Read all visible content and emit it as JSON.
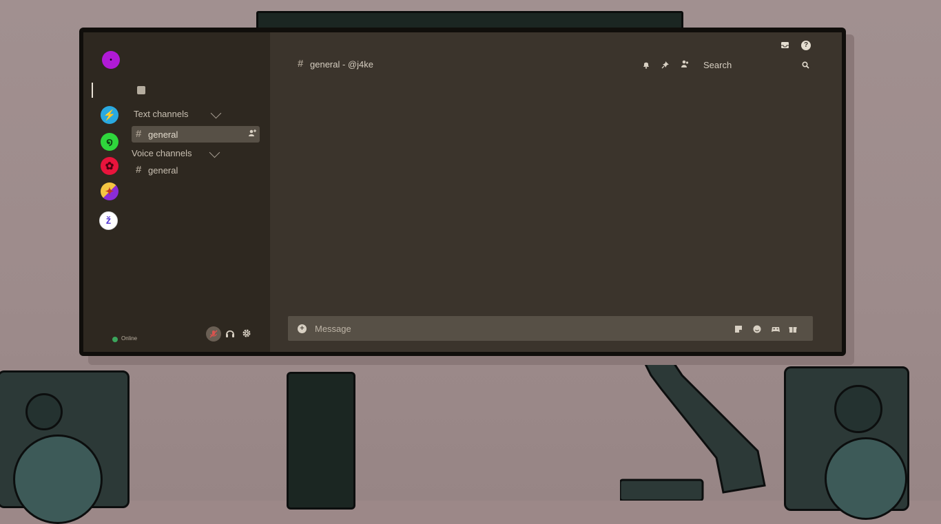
{
  "app": {
    "status": "Online"
  },
  "servers": [
    {
      "name": "lightning-server",
      "symbol": "⚡",
      "bg": "#2aa9e0",
      "fg": "#f2e23c"
    },
    {
      "name": "swirl-server",
      "symbol": "໑",
      "bg": "#2fd63c",
      "fg": "#0d3f12"
    },
    {
      "name": "flower-server",
      "symbol": "✿",
      "bg": "#e8143c",
      "fg": "#4d0010"
    },
    {
      "name": "fire-server",
      "symbol": "✦",
      "bg": "#f0a13c",
      "fg": "#8a2cd6"
    },
    {
      "name": "kanji-server",
      "symbol": "ž",
      "bg": "#ffffff",
      "fg": "#5a3fd6"
    }
  ],
  "sidebar": {
    "text_channels_label": "Text channels",
    "voice_channels_label": "Voice channels",
    "text_channels": [
      "general"
    ],
    "voice_channels": [
      "general"
    ]
  },
  "header": {
    "channel_title": "general - @j4ke",
    "search_placeholder": "Search"
  },
  "composer": {
    "placeholder": "Message"
  },
  "colors": {
    "brand": "#b01ad6",
    "status_online": "#3ba55c",
    "mic_muted": "#d9534f"
  }
}
